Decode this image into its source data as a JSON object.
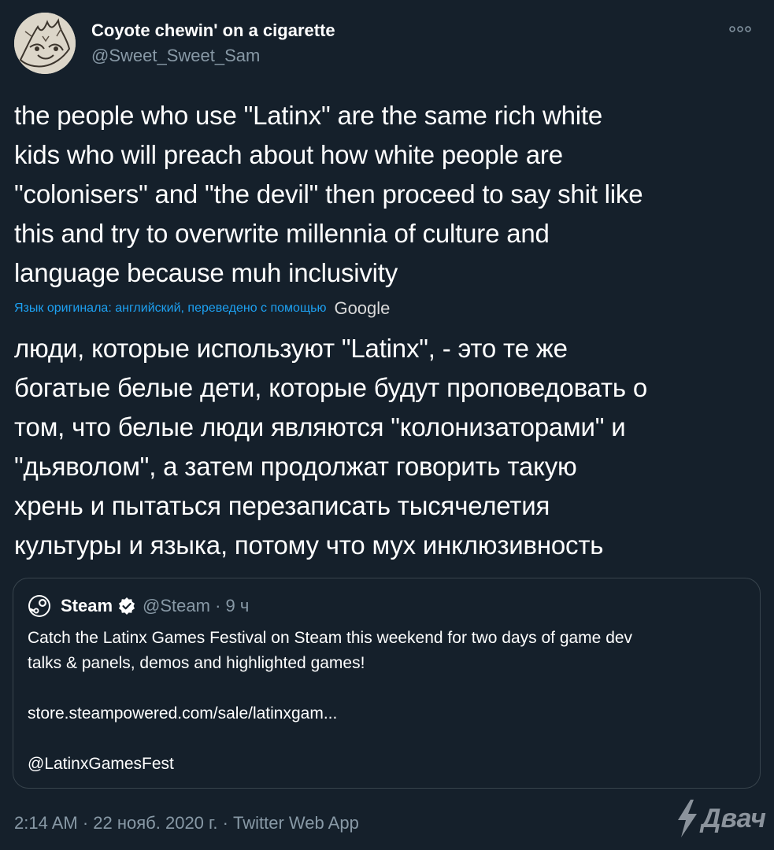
{
  "colors": {
    "background": "#15202b",
    "text_primary": "#ffffff",
    "text_secondary": "#8899a6",
    "accent": "#1da1f2",
    "border": "#38444d"
  },
  "tweet": {
    "author": {
      "display_name": "Coyote chewin' on a cigarette",
      "handle": "@Sweet_Sweet_Sam",
      "avatar_icon": "avatar-drawing"
    },
    "more_icon": "more-options-icon",
    "text_lines": [
      "the people who use \"Latinx\" are the same rich white",
      "kids who will preach about how white people are",
      "\"colonisers\" and \"the devil\" then proceed to say shit like",
      "this and try to overwrite millennia of culture and",
      "language because muh inclusivity"
    ],
    "translation": {
      "notice": "Язык оригинала: английский, переведено с помощью",
      "provider": "Google",
      "text_lines": [
        "люди, которые используют \"Latinx\", - это те же",
        "богатые белые дети, которые будут проповедовать о",
        "том, что белые люди являются \"колонизаторами\" и",
        "\"дьяволом\", а затем продолжат говорить такую",
        "хрень и пытаться перезаписать тысячелетия",
        "культуры и языка, потому что мух инклюзивность"
      ]
    },
    "quoted_tweet": {
      "author_name": "Steam",
      "author_handle_time": "@Steam · 9 ч",
      "logo_icon": "steam-logo-icon",
      "verified_icon": "verified-badge-icon",
      "body_lines": [
        "Catch the Latinx Games Festival on Steam this weekend for two days of game dev",
        "talks & panels, demos and highlighted games!"
      ],
      "link": "store.steampowered.com/sale/latinxgam...",
      "mention": "@LatinxGamesFest"
    },
    "meta": "2:14 AM · 22 нояб. 2020 г. · Twitter Web App"
  },
  "watermark": {
    "text": "Двач",
    "icon": "lightning-bolt-icon"
  }
}
